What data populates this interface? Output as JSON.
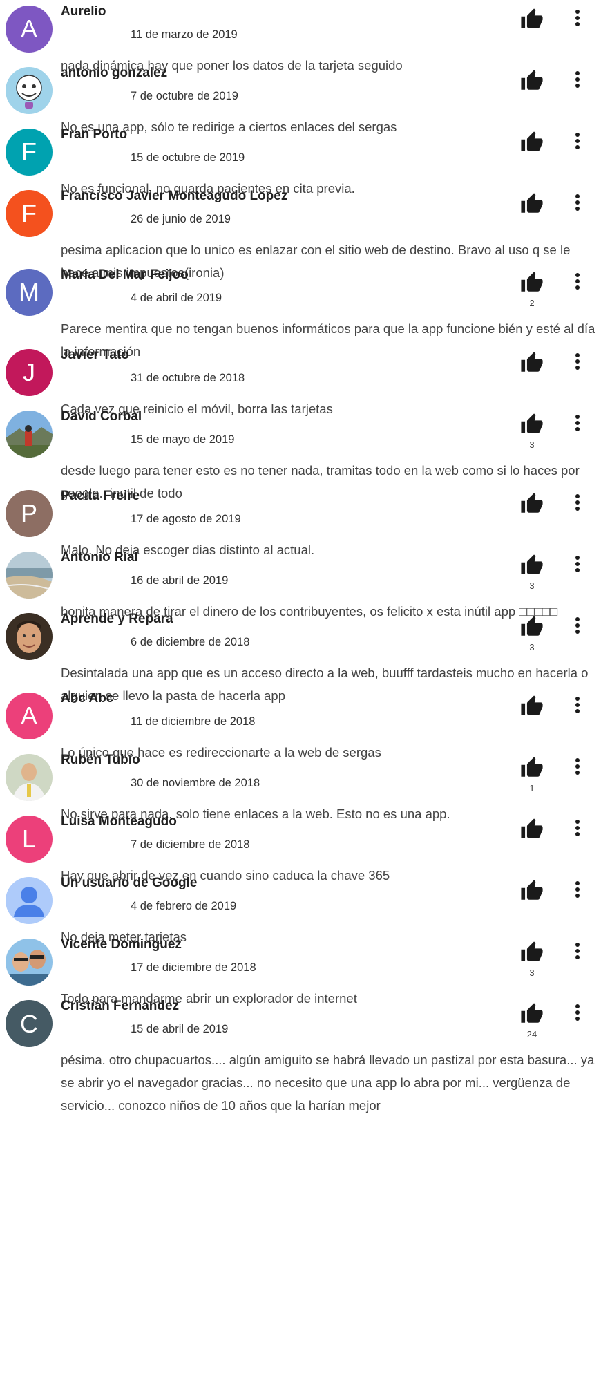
{
  "icons": {
    "like": "thumb-up-icon",
    "more": "more-vert-icon"
  },
  "reviews": [
    {
      "name": "Aurelio",
      "date": "11 de marzo de 2019",
      "text": "nada dinámica hay que poner los datos de la tarjeta seguido",
      "likes": "",
      "avatar": {
        "type": "letter",
        "letter": "A",
        "color": "#7e57c2"
      }
    },
    {
      "name": "antonio gonzalez",
      "date": "7 de octubre de 2019",
      "text": "No es una app, sólo te redirige a ciertos enlaces del sergas",
      "likes": "",
      "avatar": {
        "type": "photo",
        "kind": "cartoon"
      }
    },
    {
      "name": "Fran Porto",
      "date": "15 de octubre de 2019",
      "text": "No es funcional, no guarda pacientes en cita previa.",
      "likes": "",
      "avatar": {
        "type": "letter",
        "letter": "F",
        "color": "#00a2b0"
      }
    },
    {
      "name": "Francisco Javier Monteagudo Lopez",
      "date": "26 de junio de 2019",
      "text": "pesima aplicacion que lo unico es enlazar con el sitio web de destino. Bravo al uso q se le hace a mis impuestos(ironia)",
      "likes": "",
      "avatar": {
        "type": "letter",
        "letter": "F",
        "color": "#f4511e"
      }
    },
    {
      "name": "Maria Del Mar Feijoo",
      "date": "4 de abril de 2019",
      "text": "Parece mentira que no tengan buenos informáticos para que la app funcione bién y esté al día la información",
      "likes": "2",
      "avatar": {
        "type": "letter",
        "letter": "M",
        "color": "#5c6bc0"
      }
    },
    {
      "name": "Javier Tato",
      "date": "31 de octubre de 2018",
      "text": "Cada vez que reinicio el móvil, borra las tarjetas",
      "likes": "",
      "avatar": {
        "type": "letter",
        "letter": "J",
        "color": "#c2185b"
      }
    },
    {
      "name": "David Corbal",
      "date": "15 de mayo de 2019",
      "text": "desde luego para tener esto es no tener nada, tramitas todo en la web como si lo haces por google.. inutil de todo",
      "likes": "3",
      "avatar": {
        "type": "photo",
        "kind": "mountain"
      }
    },
    {
      "name": "Pacita Freire",
      "date": "17 de agosto de 2019",
      "text": "Malo. No deja escoger dias distinto al actual.",
      "likes": "",
      "avatar": {
        "type": "letter",
        "letter": "P",
        "color": "#8d6e63"
      }
    },
    {
      "name": "Antonio Rial",
      "date": "16 de abril de 2019",
      "text": "bonita manera de tirar el dinero de los contribuyentes, os felicito x esta inútil app □□□□□",
      "likes": "3",
      "avatar": {
        "type": "photo",
        "kind": "beach"
      }
    },
    {
      "name": "Aprende y Repara",
      "date": "6 de diciembre de 2018",
      "text": "Desintalada una app que es un acceso directo a la web, buufff tardasteis mucho en hacerla o alguien se llevo la pasta de hacerla app",
      "likes": "3",
      "avatar": {
        "type": "photo",
        "kind": "face"
      }
    },
    {
      "name": "Abc Abc",
      "date": "11 de diciembre de 2018",
      "text": "Lo único que hace es redireccionarte a la web de sergas",
      "likes": "",
      "avatar": {
        "type": "letter",
        "letter": "A",
        "color": "#ec407a"
      }
    },
    {
      "name": "Rubén Tubío",
      "date": "30 de noviembre de 2018",
      "text": "No sirve para nada, solo tiene enlaces a la web. Esto no es una app.",
      "likes": "1",
      "avatar": {
        "type": "photo",
        "kind": "person"
      }
    },
    {
      "name": "Luisa Monteagudo",
      "date": "7 de diciembre de 2018",
      "text": "Hay que abrir de vez en cuando sino caduca la chave 365",
      "likes": "",
      "avatar": {
        "type": "letter",
        "letter": "L",
        "color": "#ec407a"
      }
    },
    {
      "name": "Un usuario de Google",
      "date": "4 de febrero de 2019",
      "text": "No deja meter tarjetas",
      "likes": "",
      "avatar": {
        "type": "photo",
        "kind": "google"
      }
    },
    {
      "name": "Vicente Dominguez",
      "date": "17 de diciembre de 2018",
      "text": "Todo para mandarme abrir un explorador de internet",
      "likes": "3",
      "avatar": {
        "type": "photo",
        "kind": "group"
      }
    },
    {
      "name": "Cristian Fernandez",
      "date": "15 de abril de 2019",
      "text": "pésima. otro chupacuartos.... algún amiguito se habrá llevado un pastizal por esta basura... ya se abrir yo el navegador gracias... no necesito que una app lo abra por mi... vergüenza de servicio... conozco niños de 10 años que la harían mejor",
      "likes": "24",
      "avatar": {
        "type": "photo",
        "kind": "letterC"
      }
    }
  ]
}
